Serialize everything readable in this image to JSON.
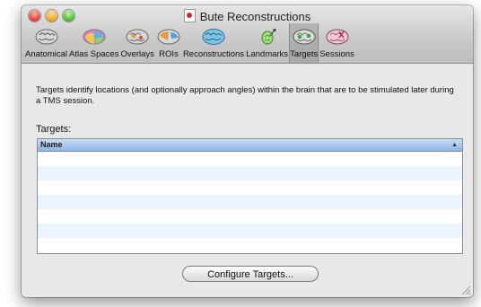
{
  "window": {
    "title": "Bute Reconstructions"
  },
  "toolbar": {
    "items": [
      {
        "label": "Anatomical",
        "icon": "brain-gray-icon"
      },
      {
        "label": "Atlas Spaces",
        "icon": "brain-color-icon"
      },
      {
        "label": "Overlays",
        "icon": "brain-overlay-icon"
      },
      {
        "label": "ROIs",
        "icon": "brain-roi-icon"
      },
      {
        "label": "Reconstructions",
        "icon": "brain-blue-icon"
      },
      {
        "label": "Landmarks",
        "icon": "pin-icon"
      },
      {
        "label": "Targets",
        "icon": "brain-target-icon"
      },
      {
        "label": "Sessions",
        "icon": "brain-session-icon"
      }
    ],
    "selected": "Targets"
  },
  "main": {
    "description": "Targets identify locations (and optionally approach angles) within the brain that are to be stimulated later during a TMS session.",
    "targets_label": "Targets:",
    "table": {
      "columns": [
        "Name"
      ],
      "rows": []
    },
    "configure_button": "Configure Targets..."
  },
  "colors": {
    "header_blue": "#9cbde6",
    "row_alt": "#edf3fe",
    "window_bg": "#e8e8e8"
  }
}
